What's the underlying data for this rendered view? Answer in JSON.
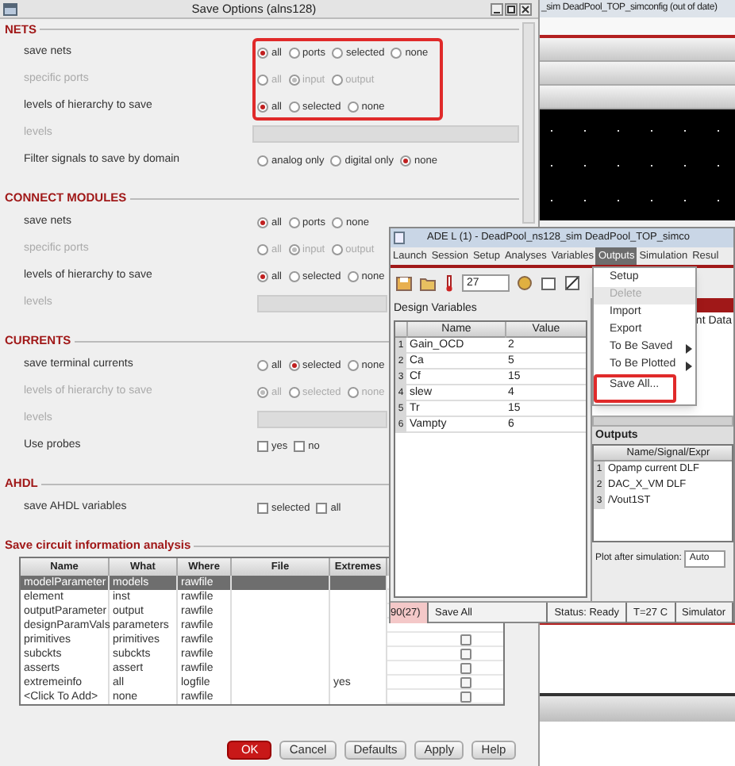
{
  "dialog": {
    "title": "Save Options (alns128)",
    "sections": [
      {
        "title": "NETS",
        "rows": [
          {
            "kind": "radio",
            "label": "save nets",
            "disabled": false,
            "options": [
              {
                "label": "all",
                "selected": true
              },
              {
                "label": "ports",
                "selected": false
              },
              {
                "label": "selected",
                "selected": false
              },
              {
                "label": "none",
                "selected": false
              }
            ]
          },
          {
            "kind": "radio",
            "label": "specific ports",
            "disabled": true,
            "options": [
              {
                "label": "all",
                "selected": false
              },
              {
                "label": "input",
                "selected": true
              },
              {
                "label": "output",
                "selected": false
              }
            ]
          },
          {
            "kind": "radio",
            "label": "levels of hierarchy to save",
            "disabled": false,
            "options": [
              {
                "label": "all",
                "selected": true
              },
              {
                "label": "selected",
                "selected": false
              },
              {
                "label": "none",
                "selected": false
              }
            ]
          },
          {
            "kind": "field",
            "label": "levels",
            "disabled": true
          },
          {
            "kind": "radio",
            "label": "Filter signals to save by domain",
            "disabled": false,
            "options": [
              {
                "label": "analog only",
                "selected": false
              },
              {
                "label": "digital only",
                "selected": false
              },
              {
                "label": "none",
                "selected": true
              }
            ]
          }
        ]
      },
      {
        "title": "CONNECT MODULES",
        "rows": [
          {
            "kind": "radio",
            "label": "save nets",
            "disabled": false,
            "options": [
              {
                "label": "all",
                "selected": true
              },
              {
                "label": "ports",
                "selected": false
              },
              {
                "label": "none",
                "selected": false
              }
            ]
          },
          {
            "kind": "radio",
            "label": "specific ports",
            "disabled": true,
            "options": [
              {
                "label": "all",
                "selected": false
              },
              {
                "label": "input",
                "selected": true
              },
              {
                "label": "output",
                "selected": false
              }
            ]
          },
          {
            "kind": "radio",
            "label": "levels of hierarchy to save",
            "disabled": false,
            "options": [
              {
                "label": "all",
                "selected": true
              },
              {
                "label": "selected",
                "selected": false
              },
              {
                "label": "none",
                "selected": false
              }
            ]
          },
          {
            "kind": "field",
            "label": "levels",
            "disabled": true
          }
        ]
      },
      {
        "title": "CURRENTS",
        "rows": [
          {
            "kind": "radio",
            "label": "save terminal currents",
            "disabled": false,
            "options": [
              {
                "label": "all",
                "selected": false
              },
              {
                "label": "selected",
                "selected": true
              },
              {
                "label": "none",
                "selected": false
              }
            ]
          },
          {
            "kind": "radio",
            "label": "levels of hierarchy to save",
            "disabled": true,
            "options": [
              {
                "label": "all",
                "selected": true
              },
              {
                "label": "selected",
                "selected": false
              },
              {
                "label": "none",
                "selected": false
              }
            ]
          },
          {
            "kind": "field",
            "label": "levels",
            "disabled": true
          },
          {
            "kind": "checkbox",
            "label": "Use probes",
            "disabled": false,
            "options": [
              {
                "label": "yes",
                "checked": false
              },
              {
                "label": "no",
                "checked": false
              }
            ]
          }
        ]
      },
      {
        "title": "AHDL",
        "rows": [
          {
            "kind": "checkbox",
            "label": "save AHDL variables",
            "disabled": false,
            "options": [
              {
                "label": "selected",
                "checked": false
              },
              {
                "label": "all",
                "checked": false
              }
            ]
          }
        ]
      }
    ],
    "table": {
      "title": "Save circuit information analysis",
      "columns": [
        "Name",
        "What",
        "Where",
        "File",
        "Extremes"
      ],
      "rows": [
        {
          "cells": [
            "modelParameter",
            "models",
            "rawfile",
            "",
            ""
          ],
          "selected": true
        },
        {
          "cells": [
            "element",
            "inst",
            "rawfile",
            "",
            ""
          ],
          "selected": false
        },
        {
          "cells": [
            "outputParameter",
            "output",
            "rawfile",
            "",
            ""
          ],
          "selected": false
        },
        {
          "cells": [
            "designParamVals",
            "parameters",
            "rawfile",
            "",
            ""
          ],
          "selected": false
        },
        {
          "cells": [
            "primitives",
            "primitives",
            "rawfile",
            "",
            ""
          ],
          "selected": false,
          "checked": false
        },
        {
          "cells": [
            "subckts",
            "subckts",
            "rawfile",
            "",
            ""
          ],
          "selected": false,
          "checked": false
        },
        {
          "cells": [
            "asserts",
            "assert",
            "rawfile",
            "",
            ""
          ],
          "selected": false,
          "checked": false
        },
        {
          "cells": [
            "extremeinfo",
            "all",
            "logfile",
            "",
            "yes"
          ],
          "selected": false,
          "checked": false
        },
        {
          "cells": [
            "<Click To Add>",
            "none",
            "rawfile",
            "",
            ""
          ],
          "selected": false,
          "checked": false
        }
      ]
    },
    "buttons": [
      {
        "label": "OK",
        "kind": "primary"
      },
      {
        "label": "Cancel",
        "kind": "normal"
      },
      {
        "label": "Defaults",
        "kind": "normal"
      },
      {
        "label": "Apply",
        "kind": "normal"
      },
      {
        "label": "Help",
        "kind": "normal"
      }
    ]
  },
  "background_window": {
    "title": "_sim DeadPool_TOP_simconfig (out of date)"
  },
  "ade_window": {
    "title": "ADE L (1) - DeadPool_ns128_sim DeadPool_TOP_simco",
    "menus": [
      {
        "label": "Launch",
        "selected": false
      },
      {
        "label": "Session",
        "selected": false
      },
      {
        "label": "Setup",
        "selected": false
      },
      {
        "label": "Analyses",
        "selected": false
      },
      {
        "label": "Variables",
        "selected": false
      },
      {
        "label": "Outputs",
        "selected": true
      },
      {
        "label": "Simulation",
        "selected": false
      },
      {
        "label": "Resul",
        "selected": false
      }
    ],
    "temperature": {
      "value": "27"
    },
    "design_variables": {
      "title": "Design Variables",
      "columns": [
        "Name",
        "Value"
      ],
      "rows": [
        {
          "index": "1",
          "name": "Gain_OCD",
          "value": "2"
        },
        {
          "index": "2",
          "name": "Ca",
          "value": "5"
        },
        {
          "index": "3",
          "name": "Cf",
          "value": "15"
        },
        {
          "index": "4",
          "name": "slew",
          "value": "4"
        },
        {
          "index": "5",
          "name": "Tr",
          "value": "15"
        },
        {
          "index": "6",
          "name": "Vampty",
          "value": "6"
        }
      ]
    },
    "analyses_fragment": "nt Data",
    "outputs_menu": [
      {
        "label": "Setup",
        "disabled": false,
        "submenu": false
      },
      {
        "label": "Delete",
        "disabled": true,
        "submenu": false
      },
      {
        "label": "Import",
        "disabled": false,
        "submenu": false
      },
      {
        "label": "Export",
        "disabled": false,
        "submenu": false
      },
      {
        "label": "To Be Saved",
        "disabled": false,
        "submenu": true
      },
      {
        "label": "To Be Plotted",
        "disabled": false,
        "submenu": true
      },
      {
        "label": "Save All...",
        "disabled": false,
        "submenu": false,
        "highlighted": true
      }
    ],
    "outputs": {
      "title": "Outputs",
      "columns": [
        "Name/Signal/Expr"
      ],
      "rows": [
        {
          "index": "1",
          "name": "Opamp current DLF"
        },
        {
          "index": "2",
          "name": "DAC_X_VM DLF"
        },
        {
          "index": "3",
          "name": "/Vout1ST"
        }
      ]
    },
    "plot_after": {
      "label": "Plot after simulation:",
      "value": "Auto"
    },
    "status_bar": [
      {
        "text": "90(27)",
        "kind": "alert"
      },
      {
        "text": "Save All",
        "kind": "plain"
      },
      {
        "text": "Status: Ready",
        "kind": "plain"
      },
      {
        "text": "T=27 C",
        "kind": "plain"
      },
      {
        "text": "Simulator",
        "kind": "plain"
      }
    ]
  }
}
